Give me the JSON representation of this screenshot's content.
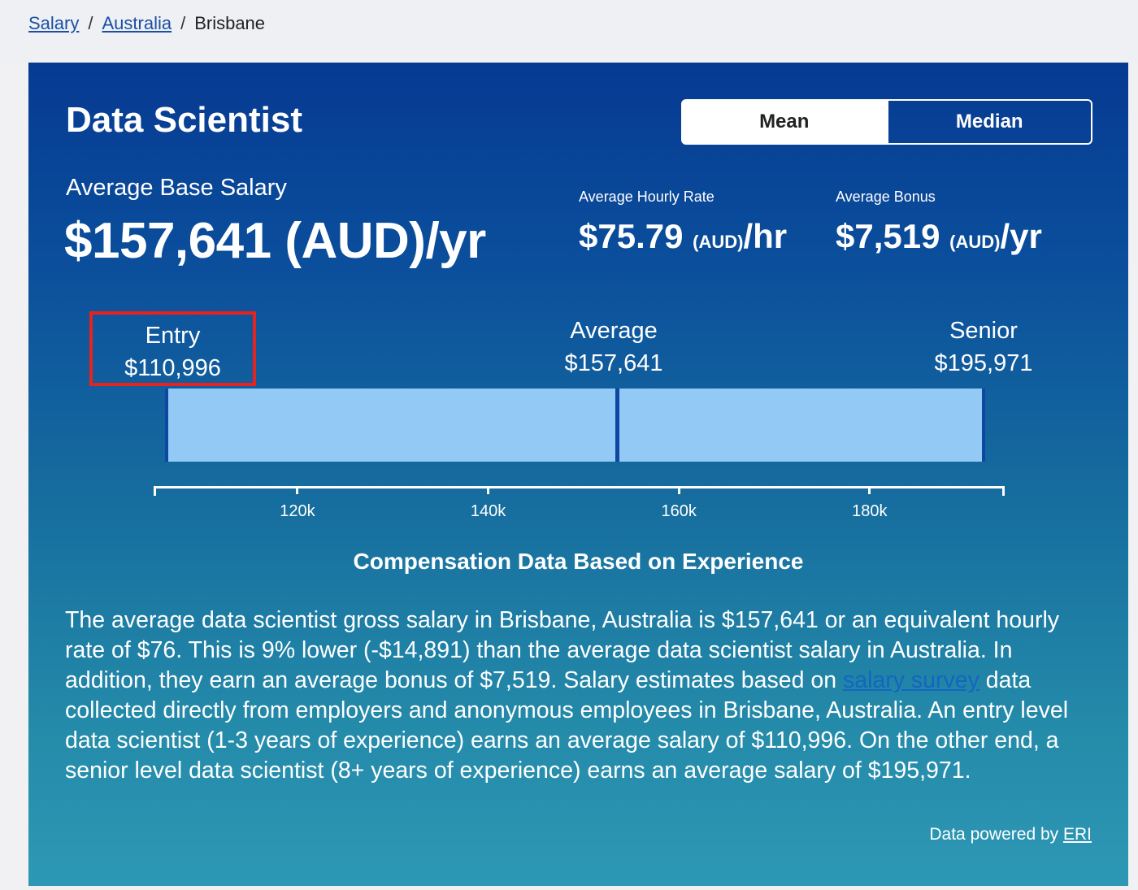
{
  "breadcrumb": {
    "items": [
      "Salary",
      "Australia"
    ],
    "current": "Brisbane",
    "separator": "/"
  },
  "job_title": "Data Scientist",
  "toggle": {
    "mean_label": "Mean",
    "median_label": "Median",
    "selected": "Mean"
  },
  "base_salary": {
    "label": "Average Base Salary",
    "value": "$157,641 (AUD)/yr"
  },
  "hourly": {
    "label": "Average Hourly Rate",
    "amount": "$75.79",
    "currency": "(AUD)",
    "unit": "/hr"
  },
  "bonus": {
    "label": "Average Bonus",
    "amount": "$7,519",
    "currency": "(AUD)",
    "unit": "/yr"
  },
  "levels": {
    "entry": {
      "label": "Entry",
      "value": "$110,996"
    },
    "average": {
      "label": "Average",
      "value": "$157,641"
    },
    "senior": {
      "label": "Senior",
      "value": "$195,971"
    }
  },
  "chart_data": {
    "type": "bar",
    "orientation": "horizontal-range",
    "categories": [
      "Entry",
      "Average",
      "Senior"
    ],
    "values": [
      110996,
      157641,
      195971
    ],
    "xlim": [
      105000,
      194000
    ],
    "x_ticks": [
      120000,
      140000,
      160000,
      180000
    ],
    "x_tick_labels": [
      "120k",
      "140k",
      "160k",
      "180k"
    ],
    "title": "Compensation Data Based on Experience",
    "grid": false
  },
  "description": {
    "part1": "The average data scientist gross salary in Brisbane, Australia is $157,641 or an equivalent hourly rate of $76. This is 9% lower (-$14,891) than the average data scientist salary in Australia. In addition, they earn an average bonus of $7,519. Salary estimates based on ",
    "link": "salary survey",
    "part2": " data collected directly from employers and anonymous employees in Brisbane, Australia. An entry level data scientist (1-3 years of experience) earns an average salary of $110,996. On the other end, a senior level data scientist (8+ years of experience) earns an average salary of $195,971."
  },
  "powered_by": {
    "text": "Data powered by ",
    "link": "ERI"
  },
  "colors": {
    "panel_top": "#063a92",
    "panel_bottom": "#2d98b5",
    "bar_fill": "#92c9f5",
    "bar_border": "#0d47a1",
    "highlight": "#e8231d",
    "link": "#1565c0"
  }
}
